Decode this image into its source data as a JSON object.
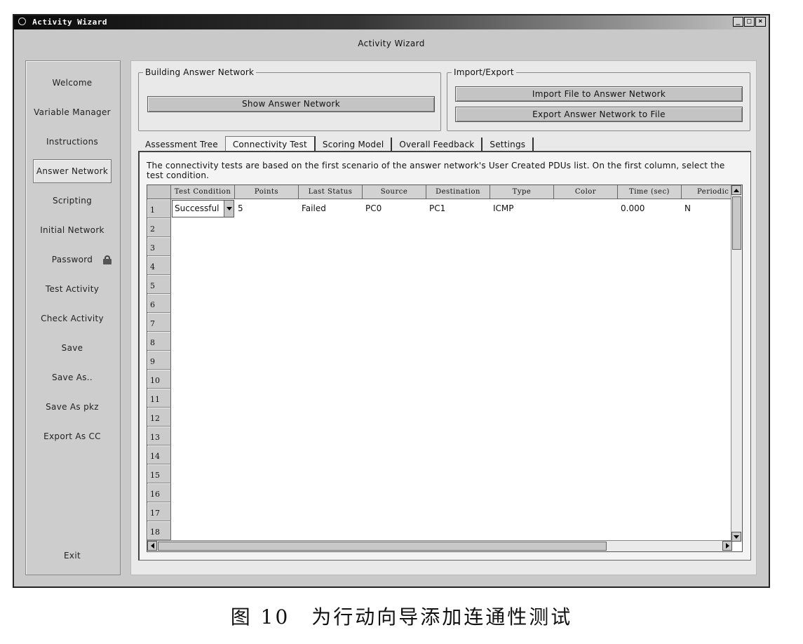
{
  "window": {
    "title": "Activity Wizard",
    "controls": [
      "_",
      "□",
      "×"
    ]
  },
  "header": {
    "title": "Activity Wizard"
  },
  "sidebar": {
    "items": [
      {
        "label": "Welcome"
      },
      {
        "label": "Variable Manager"
      },
      {
        "label": "Instructions"
      },
      {
        "label": "Answer Network",
        "active": true
      },
      {
        "label": "Scripting"
      },
      {
        "label": "Initial Network"
      },
      {
        "label": "Password",
        "icon": "lock-icon"
      },
      {
        "label": "Test Activity"
      },
      {
        "label": "Check Activity"
      },
      {
        "label": "Save"
      },
      {
        "label": "Save As.."
      },
      {
        "label": "Save As pkz"
      },
      {
        "label": "Export As CC"
      }
    ],
    "exit_label": "Exit"
  },
  "building": {
    "legend": "Building Answer Network",
    "show_button": "Show Answer Network"
  },
  "import_export": {
    "legend": "Import/Export",
    "import_button": "Import File to Answer Network",
    "export_button": "Export Answer Network to File"
  },
  "tabs": [
    {
      "label": "Assessment Tree"
    },
    {
      "label": "Connectivity Test",
      "active": true
    },
    {
      "label": "Scoring Model"
    },
    {
      "label": "Overall Feedback"
    },
    {
      "label": "Settings"
    }
  ],
  "connectivity": {
    "description": "The connectivity tests are based on the first scenario of the answer network's User Created PDUs list. On the first column, select the test condition.",
    "columns": [
      "Test Condition",
      "Points",
      "Last Status",
      "Source",
      "Destination",
      "Type",
      "Color",
      "Time (sec)",
      "Periodic"
    ],
    "rows": [
      {
        "test_condition": "Successful",
        "points": "5",
        "last_status": "Failed",
        "source": "PC0",
        "destination": "PC1",
        "type": "ICMP",
        "color": "",
        "time": "0.000",
        "periodic": "N"
      }
    ],
    "row_numbers": [
      "1",
      "2",
      "3",
      "4",
      "5",
      "6",
      "7",
      "8",
      "9",
      "10",
      "11",
      "12",
      "13",
      "14",
      "15",
      "16",
      "17",
      "18"
    ]
  },
  "caption": "图 10　为行动向导添加连通性测试"
}
